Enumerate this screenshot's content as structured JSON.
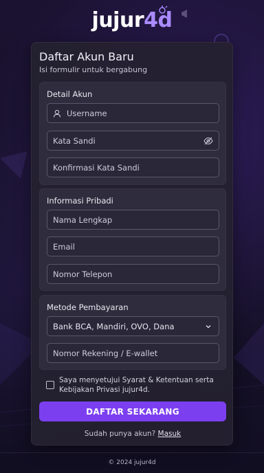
{
  "logo": {
    "part1": "jujur",
    "part2": "4d"
  },
  "form": {
    "title": "Daftar Akun Baru",
    "subtitle": "Isi formulir untuk bergabung"
  },
  "account": {
    "title": "Detail Akun",
    "username_placeholder": "Username",
    "password_placeholder": "Kata Sandi",
    "confirm_placeholder": "Konfirmasi Kata Sandi"
  },
  "personal": {
    "title": "Informasi Pribadi",
    "fullname_placeholder": "Nama Lengkap",
    "email_placeholder": "Email",
    "phone_placeholder": "Nomor Telepon"
  },
  "payment": {
    "title": "Metode Pembayaran",
    "method_selected": "Bank BCA, Mandiri, OVO, Dana",
    "account_placeholder": "Nomor Rekening / E-wallet"
  },
  "terms": {
    "text": "Saya menyetujui Syarat & Ketentuan serta Kebijakan Privasi jujur4d."
  },
  "submit": {
    "label": "DAFTAR SEKARANG"
  },
  "login": {
    "prompt": "Sudah punya akun?",
    "link": "Masuk"
  },
  "footer": {
    "text": "© 2024 jujur4d"
  },
  "icons": {
    "username": "user-icon",
    "password_toggle": "eye-off-icon",
    "select": "chevron-down-icon"
  },
  "colors": {
    "accent": "#7b3ff0",
    "logo_accent": "#a98bff",
    "background": "#17122a"
  }
}
